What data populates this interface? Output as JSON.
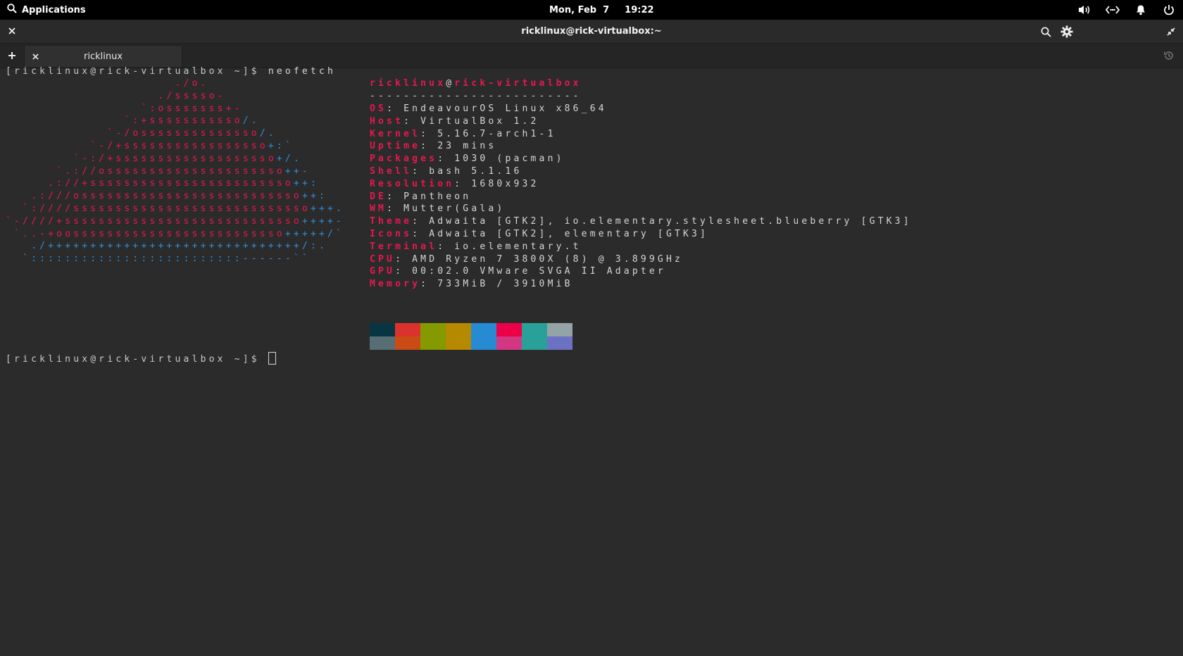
{
  "panel": {
    "applications_label": "Applications",
    "date": "Mon, Feb  7",
    "time": "19:22",
    "indicators": [
      "volume-icon",
      "network-icon",
      "notifications-icon",
      "power-icon"
    ]
  },
  "window": {
    "title": "ricklinux@rick-virtualbox:~"
  },
  "tabs": [
    {
      "label": "ricklinux"
    }
  ],
  "terminal": {
    "command_prompt": "[ricklinux@rick-virtualbox ~]$ ",
    "command": "neofetch",
    "final_prompt": "[ricklinux@rick-virtualbox ~]$ ",
    "logo": [
      [
        {
          "t": "                    ",
          "c": ""
        },
        {
          "t": "./o.",
          "c": "r"
        }
      ],
      [
        {
          "t": "                  ",
          "c": ""
        },
        {
          "t": "./sssso-",
          "c": "r"
        }
      ],
      [
        {
          "t": "                ",
          "c": ""
        },
        {
          "t": "`:osssssss+-",
          "c": "r"
        }
      ],
      [
        {
          "t": "              ",
          "c": ""
        },
        {
          "t": "`:+sssssssssso",
          "c": "r"
        },
        {
          "t": "/.",
          "c": "b"
        }
      ],
      [
        {
          "t": "            ",
          "c": ""
        },
        {
          "t": "`-/ossssssssssssso",
          "c": "r"
        },
        {
          "t": "/.",
          "c": "b"
        }
      ],
      [
        {
          "t": "          ",
          "c": ""
        },
        {
          "t": "`-/+sssssssssssssssso",
          "c": "r"
        },
        {
          "t": "+:`",
          "c": "b"
        }
      ],
      [
        {
          "t": "        ",
          "c": ""
        },
        {
          "t": "`-:/+sssssssssssssssssso",
          "c": "r"
        },
        {
          "t": "+/.",
          "c": "b"
        }
      ],
      [
        {
          "t": "      ",
          "c": ""
        },
        {
          "t": "`.://osssssssssssssssssssso",
          "c": "r"
        },
        {
          "t": "++-",
          "c": "b"
        }
      ],
      [
        {
          "t": "     ",
          "c": ""
        },
        {
          "t": ".://+ssssssssssssssssssssssso",
          "c": "r"
        },
        {
          "t": "++:",
          "c": "b"
        }
      ],
      [
        {
          "t": "   ",
          "c": ""
        },
        {
          "t": ".:///ossssssssssssssssssssssssso",
          "c": "r"
        },
        {
          "t": "++:",
          "c": "b"
        }
      ],
      [
        {
          "t": "  ",
          "c": ""
        },
        {
          "t": "`:////ssssssssssssssssssssssssssso",
          "c": "r"
        },
        {
          "t": "+++.",
          "c": "b"
        }
      ],
      [
        {
          "t": "",
          "c": ""
        },
        {
          "t": "`-////+ssssssssssssssssssssssssssso",
          "c": "r"
        },
        {
          "t": "++++-",
          "c": "b"
        }
      ],
      [
        {
          "t": " ",
          "c": ""
        },
        {
          "t": "`..-+oosssssssssssssssssssssssso",
          "c": "r"
        },
        {
          "t": "+++++/`",
          "c": "b"
        }
      ],
      [
        {
          "t": "   ",
          "c": ""
        },
        {
          "t": "./++++++++++++++++++++++++++++++/:.",
          "c": "b"
        }
      ],
      [
        {
          "t": "  ",
          "c": ""
        },
        {
          "t": "`:::::::::::::::::::::::::------``",
          "c": "b"
        }
      ]
    ],
    "info": {
      "user": "ricklinux",
      "at": "@",
      "host": "rick-virtualbox",
      "separator": "-------------------------",
      "rows": [
        {
          "key": "OS",
          "value": "EndeavourOS Linux x86_64"
        },
        {
          "key": "Host",
          "value": "VirtualBox 1.2"
        },
        {
          "key": "Kernel",
          "value": "5.16.7-arch1-1"
        },
        {
          "key": "Uptime",
          "value": "23 mins"
        },
        {
          "key": "Packages",
          "value": "1030 (pacman)"
        },
        {
          "key": "Shell",
          "value": "bash 5.1.16"
        },
        {
          "key": "Resolution",
          "value": "1680x932"
        },
        {
          "key": "DE",
          "value": "Pantheon"
        },
        {
          "key": "WM",
          "value": "Mutter(Gala)"
        },
        {
          "key": "Theme",
          "value": "Adwaita [GTK2], io.elementary.stylesheet.blueberry [GTK3]"
        },
        {
          "key": "Icons",
          "value": "Adwaita [GTK2], elementary [GTK3]"
        },
        {
          "key": "Terminal",
          "value": "io.elementary.t"
        },
        {
          "key": "CPU",
          "value": "AMD Ryzen 7 3800X (8) @ 3.899GHz"
        },
        {
          "key": "GPU",
          "value": "00:02.0 VMware SVGA II Adapter"
        },
        {
          "key": "Memory",
          "value": "733MiB / 3910MiB"
        }
      ],
      "palette_top": [
        "#073642",
        "#dc322f",
        "#859900",
        "#b58900",
        "#268bd2",
        "#ec0048",
        "#2aa198",
        "#94a3a5"
      ],
      "palette_bottom": [
        "#586e75",
        "#cb4b16",
        "#859900",
        "#b58900",
        "#268bd2",
        "#d33682",
        "#2aa198",
        "#6c71c4"
      ]
    }
  }
}
